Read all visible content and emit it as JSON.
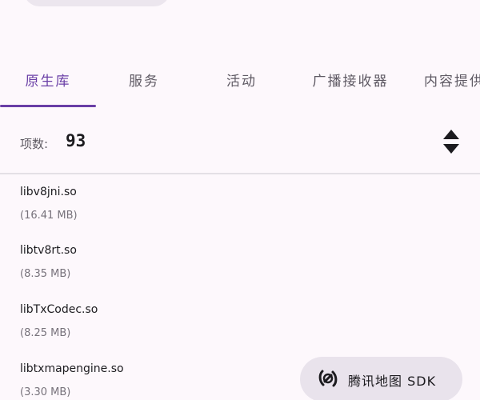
{
  "tabs": [
    {
      "label": "原生库",
      "active": true
    },
    {
      "label": "服务",
      "active": false
    },
    {
      "label": "活动",
      "active": false
    },
    {
      "label": "广播接收器",
      "active": false
    },
    {
      "label": "内容提供者",
      "active": false
    }
  ],
  "summary": {
    "count_label": "项数:",
    "count_value": "93"
  },
  "items": [
    {
      "name": "libv8jni.so",
      "size": "(16.41 MB)"
    },
    {
      "name": "libtv8rt.so",
      "size": "(8.35 MB)"
    },
    {
      "name": "libTxCodec.so",
      "size": "(8.25 MB)"
    },
    {
      "name": "libtxmapengine.so",
      "size": "(3.30 MB)"
    }
  ],
  "fab": {
    "label": "腾讯地图 SDK",
    "icon": "tencent-map-icon"
  },
  "colors": {
    "accent": "#6a3fa6",
    "background": "#fdf8fc",
    "fab_background": "#e9e3ec"
  }
}
